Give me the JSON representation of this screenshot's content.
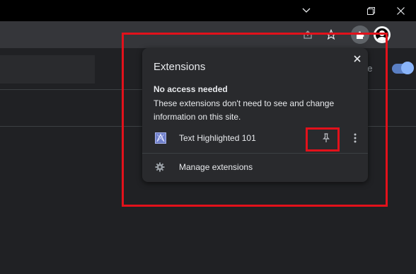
{
  "colors": {
    "titlebar": "#000000",
    "toolbar": "#35363a",
    "page_bg": "#202124",
    "popup_bg": "#292a2d",
    "text": "#e8eaed",
    "highlight": "#e2111b",
    "toggle_on": "#8ab4f8"
  },
  "window_controls": {
    "icons": [
      "chevron-down-icon",
      "restore-icon",
      "close-icon"
    ]
  },
  "toolbar": {
    "icons": [
      "share-icon",
      "star-icon",
      "puzzle-icon",
      "avatar-icon"
    ]
  },
  "background_page": {
    "partial_label": "de",
    "toggle_on": true
  },
  "popup": {
    "title": "Extensions",
    "section_heading": "No access needed",
    "section_description": "These extensions don't need to see and change information on this site.",
    "extensions": [
      {
        "name": "Text Highlighted 101",
        "icon": "extension-logo-icon",
        "pin_icon": "pin-icon",
        "more_icon": "more-vert-icon"
      }
    ],
    "manage_label": "Manage extensions",
    "manage_icon": "gear-icon",
    "close_icon": "close-icon"
  }
}
